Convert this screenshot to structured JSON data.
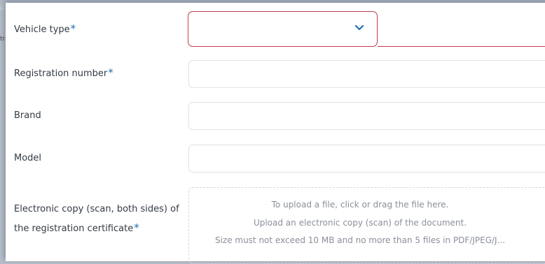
{
  "backdrop": {
    "fragment": "tra"
  },
  "form": {
    "vehicle_type": {
      "label": "Vehicle type",
      "required_mark": "*",
      "value": ""
    },
    "registration_number": {
      "label": "Registration number",
      "required_mark": "*",
      "value": ""
    },
    "brand": {
      "label": "Brand",
      "value": ""
    },
    "model": {
      "label": "Model",
      "value": ""
    },
    "certificate": {
      "label_line1": "Electronic copy (scan, both sides) of",
      "label_line2": "the registration certificate",
      "required_mark": "*",
      "upload_lines": [
        "To upload a file, click or drag the file here.",
        "Upload an electronic copy (scan) of the document.",
        "Size must not exceed 10 MB and no more than 5 files in PDF/JPEG/J..."
      ]
    }
  },
  "colors": {
    "required": "#1e6fb8",
    "error_border": "#c43a4b",
    "field_border": "#dfe3e8"
  },
  "icons": {
    "select_toggle": "chevron-down-icon"
  }
}
